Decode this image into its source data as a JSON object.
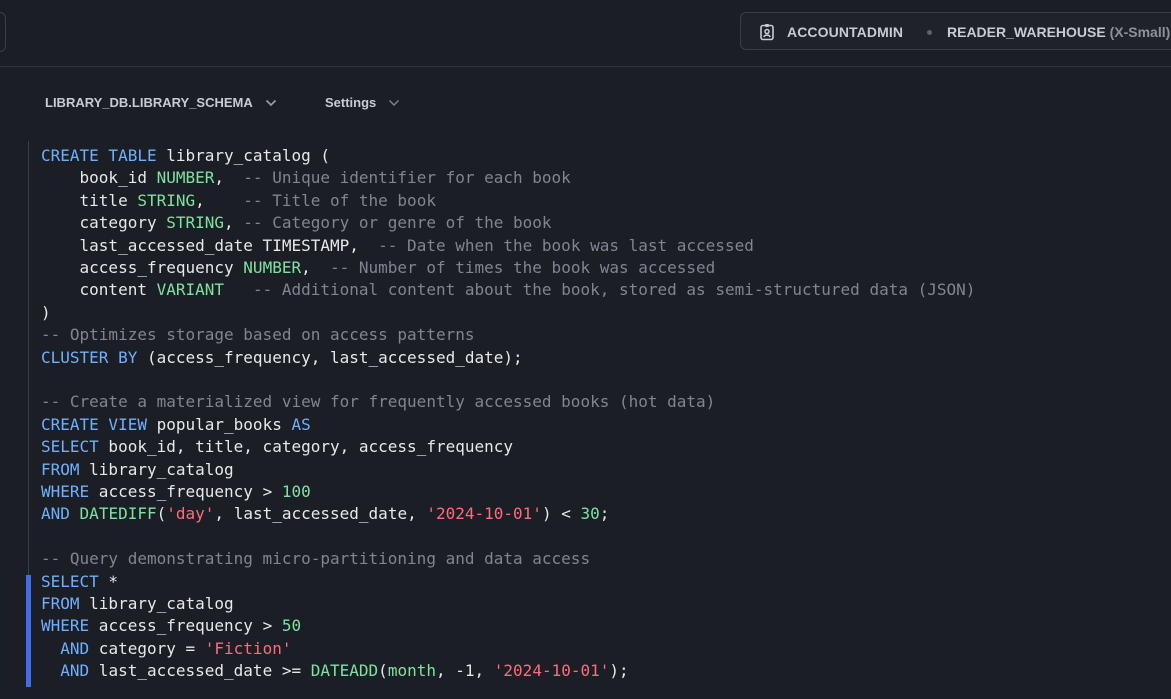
{
  "header": {
    "role": "ACCOUNTADMIN",
    "warehouse_name": "READER_WAREHOUSE",
    "warehouse_size": "(X-Small)"
  },
  "toolbar": {
    "database_schema": "LIBRARY_DB.LIBRARY_SCHEMA",
    "settings_label": "Settings"
  },
  "icons": {
    "role": "id-badge-icon",
    "dropdown": "chevron-down-icon"
  },
  "colors": {
    "keyword": "#6fb0ff",
    "type": "#7ee3a0",
    "comment": "#7f8591",
    "string": "#ff6b7d",
    "active_line_bar": "#3f6ee8"
  },
  "editor": {
    "lines": [
      [
        {
          "t": "kw",
          "v": "CREATE TABLE"
        },
        {
          "t": "",
          "v": " library_catalog ("
        }
      ],
      [
        {
          "t": "",
          "v": "    book_id "
        },
        {
          "t": "ty",
          "v": "NUMBER"
        },
        {
          "t": "",
          "v": ",  "
        },
        {
          "t": "cm",
          "v": "-- Unique identifier for each book"
        }
      ],
      [
        {
          "t": "",
          "v": "    title "
        },
        {
          "t": "ty",
          "v": "STRING"
        },
        {
          "t": "",
          "v": ",    "
        },
        {
          "t": "cm",
          "v": "-- Title of the book"
        }
      ],
      [
        {
          "t": "",
          "v": "    category "
        },
        {
          "t": "ty",
          "v": "STRING"
        },
        {
          "t": "",
          "v": ", "
        },
        {
          "t": "cm",
          "v": "-- Category or genre of the book"
        }
      ],
      [
        {
          "t": "",
          "v": "    last_accessed_date TIMESTAMP,  "
        },
        {
          "t": "cm",
          "v": "-- Date when the book was last accessed"
        }
      ],
      [
        {
          "t": "",
          "v": "    access_frequency "
        },
        {
          "t": "ty",
          "v": "NUMBER"
        },
        {
          "t": "",
          "v": ",  "
        },
        {
          "t": "cm",
          "v": "-- Number of times the book was accessed"
        }
      ],
      [
        {
          "t": "",
          "v": "    content "
        },
        {
          "t": "ty",
          "v": "VARIANT"
        },
        {
          "t": "",
          "v": "   "
        },
        {
          "t": "cm",
          "v": "-- Additional content about the book, stored as semi-structured data (JSON)"
        }
      ],
      [
        {
          "t": "",
          "v": ")"
        }
      ],
      [
        {
          "t": "cm",
          "v": "-- Optimizes storage based on access patterns"
        }
      ],
      [
        {
          "t": "kw",
          "v": "CLUSTER BY"
        },
        {
          "t": "",
          "v": " (access_frequency, last_accessed_date);"
        }
      ],
      [
        {
          "t": "",
          "v": ""
        }
      ],
      [
        {
          "t": "cm",
          "v": "-- Create a materialized view for frequently accessed books (hot data)"
        }
      ],
      [
        {
          "t": "kw",
          "v": "CREATE VIEW"
        },
        {
          "t": "",
          "v": " popular_books "
        },
        {
          "t": "kw",
          "v": "AS"
        }
      ],
      [
        {
          "t": "kw",
          "v": "SELECT"
        },
        {
          "t": "",
          "v": " book_id, title, category, access_frequency"
        }
      ],
      [
        {
          "t": "kw",
          "v": "FROM"
        },
        {
          "t": "",
          "v": " library_catalog"
        }
      ],
      [
        {
          "t": "kw",
          "v": "WHERE"
        },
        {
          "t": "",
          "v": " access_frequency > "
        },
        {
          "t": "nu",
          "v": "100"
        }
      ],
      [
        {
          "t": "kw",
          "v": "AND"
        },
        {
          "t": "",
          "v": " "
        },
        {
          "t": "ty",
          "v": "DATEDIFF"
        },
        {
          "t": "",
          "v": "("
        },
        {
          "t": "st",
          "v": "'day'"
        },
        {
          "t": "",
          "v": ", last_accessed_date, "
        },
        {
          "t": "st",
          "v": "'2024-10-01'"
        },
        {
          "t": "",
          "v": ") < "
        },
        {
          "t": "nu",
          "v": "30"
        },
        {
          "t": "",
          "v": ";"
        }
      ],
      [
        {
          "t": "",
          "v": ""
        }
      ],
      [
        {
          "t": "cm",
          "v": "-- Query demonstrating micro-partitioning and data access"
        }
      ],
      [
        {
          "t": "kw",
          "v": "SELECT"
        },
        {
          "t": "",
          "v": " *"
        }
      ],
      [
        {
          "t": "kw",
          "v": "FROM"
        },
        {
          "t": "",
          "v": " library_catalog"
        }
      ],
      [
        {
          "t": "kw",
          "v": "WHERE"
        },
        {
          "t": "",
          "v": " access_frequency > "
        },
        {
          "t": "nu",
          "v": "50"
        }
      ],
      [
        {
          "t": "",
          "v": "  "
        },
        {
          "t": "kw",
          "v": "AND"
        },
        {
          "t": "",
          "v": " category = "
        },
        {
          "t": "st",
          "v": "'Fiction'"
        }
      ],
      [
        {
          "t": "",
          "v": "  "
        },
        {
          "t": "kw",
          "v": "AND"
        },
        {
          "t": "",
          "v": " last_accessed_date >= "
        },
        {
          "t": "ty",
          "v": "DATEADD"
        },
        {
          "t": "",
          "v": "("
        },
        {
          "t": "ty",
          "v": "month"
        },
        {
          "t": "",
          "v": ", -1, "
        },
        {
          "t": "st",
          "v": "'2024-10-01'"
        },
        {
          "t": "",
          "v": ");"
        }
      ]
    ]
  }
}
